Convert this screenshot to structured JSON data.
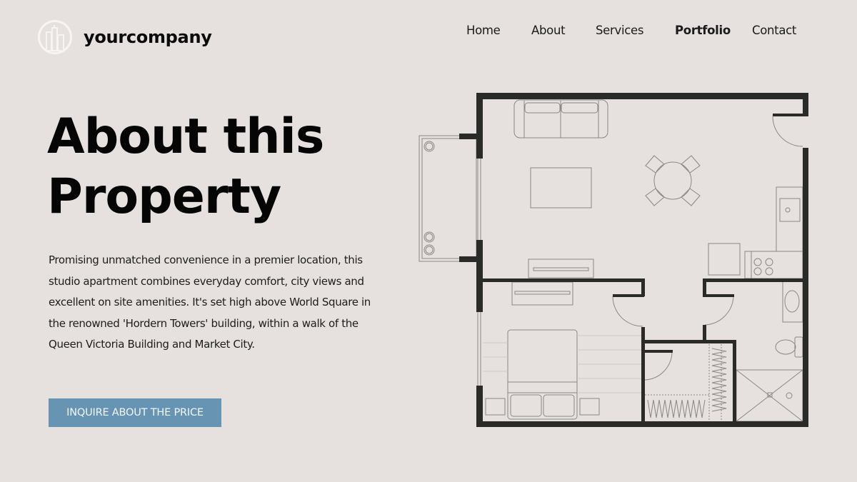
{
  "brand": {
    "name": "yourcompany",
    "logo_icon": "building-logo-icon"
  },
  "nav": {
    "items": [
      {
        "label": "Home",
        "active": false
      },
      {
        "label": "About",
        "active": false
      },
      {
        "label": "Services",
        "active": false
      },
      {
        "label": "Portfolio",
        "active": true
      },
      {
        "label": "Contact",
        "active": false
      }
    ]
  },
  "hero": {
    "title_line1": "About this",
    "title_line2": "Property",
    "description": "Promising unmatched convenience in a premier location, this studio apartment combines everyday comfort, city views and excellent on site amenities. It's set high above World Square in the renowned 'Hordern Towers' building, within a walk of the Queen Victoria Building and Market City.",
    "cta_label": "INQUIRE ABOUT THE PRICE"
  },
  "floorplan": {
    "image": "floor-plan-drawing",
    "rooms": [
      "balcony",
      "living-room",
      "dining-area",
      "kitchen",
      "bedroom",
      "walk-in-wardrobe",
      "bathroom",
      "entry"
    ]
  },
  "colors": {
    "background": "#e6e1de",
    "accent": "#6894b4",
    "wall": "#2a2a28",
    "text": "#111111"
  }
}
